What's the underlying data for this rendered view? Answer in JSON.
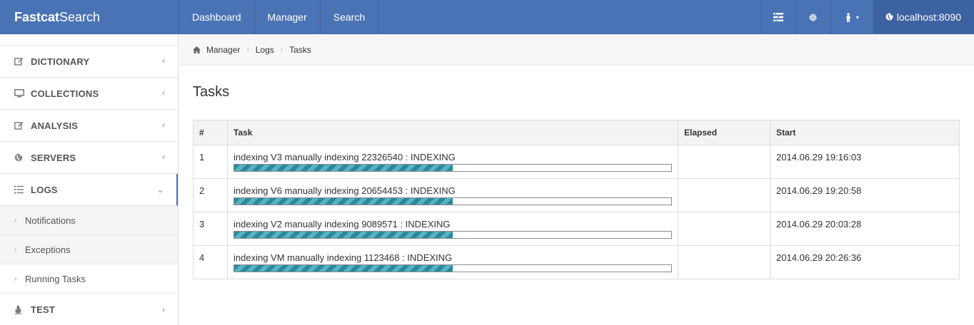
{
  "navbar": {
    "brand_bold": "Fastcat",
    "brand_light": "Search",
    "links": [
      "Dashboard",
      "Manager",
      "Search"
    ],
    "host": "localhost:8090"
  },
  "sidebar": {
    "items": [
      {
        "label": "DICTIONARY",
        "icon": "edit-icon"
      },
      {
        "label": "COLLECTIONS",
        "icon": "monitor-icon"
      },
      {
        "label": "ANALYSIS",
        "icon": "edit-icon"
      },
      {
        "label": "SERVERS",
        "icon": "globe-icon"
      },
      {
        "label": "LOGS",
        "icon": "list-icon"
      }
    ],
    "sub_items": [
      "Notifications",
      "Exceptions",
      "Running Tasks"
    ],
    "last_item": {
      "label": "TEST",
      "icon": "fire-icon"
    }
  },
  "breadcrumb": [
    "Manager",
    "Logs",
    "Tasks"
  ],
  "page_title": "Tasks",
  "table": {
    "headers": [
      "#",
      "Task",
      "Elapsed",
      "Start"
    ],
    "rows": [
      {
        "num": "1",
        "task": "indexing V3 manually indexing 22326540 : INDEXING",
        "progress": 0.5,
        "elapsed": "",
        "start": "2014.06.29 19:16:03"
      },
      {
        "num": "2",
        "task": "indexing V6 manually indexing 20654453 : INDEXING",
        "progress": 0.5,
        "elapsed": "",
        "start": "2014.06.29 19:20:58"
      },
      {
        "num": "3",
        "task": "indexing V2 manually indexing 9089571 : INDEXING",
        "progress": 0.5,
        "elapsed": "",
        "start": "2014.06.29 20:03:28"
      },
      {
        "num": "4",
        "task": "indexing VM manually indexing 1123468 : INDEXING",
        "progress": 0.5,
        "elapsed": "",
        "start": "2014.06.29 20:26:36"
      }
    ]
  },
  "colors": {
    "navbar": "#4a73b6",
    "progress": "#2a8a9c"
  }
}
